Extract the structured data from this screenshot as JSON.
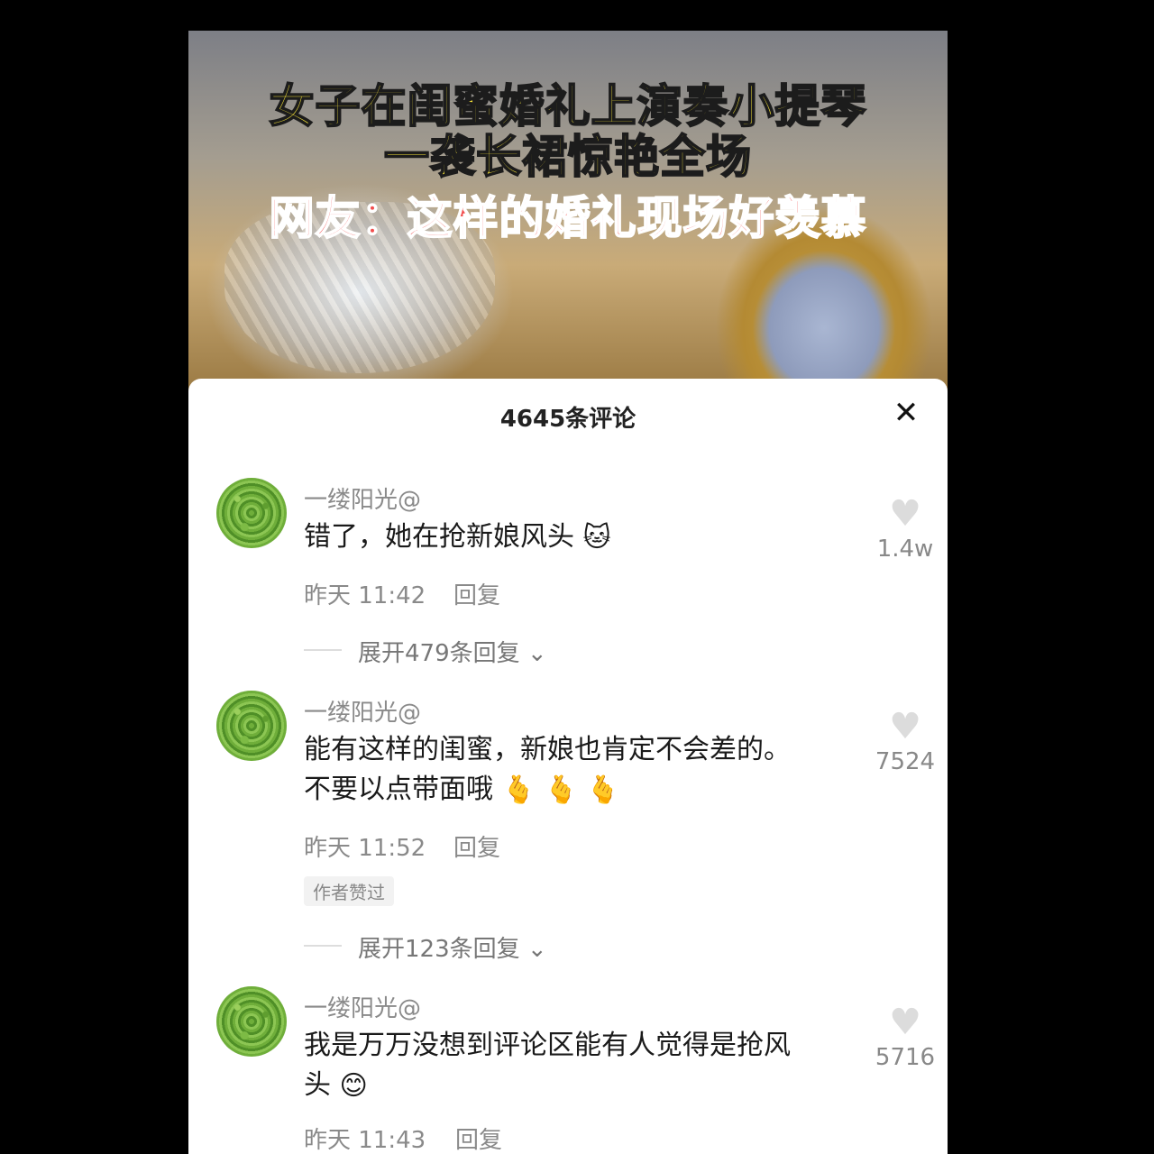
{
  "video": {
    "caption_line1": "女子在闺蜜婚礼上演奏小提琴",
    "caption_line2": "一袭长裙惊艳全场",
    "caption_line3": "网友：这样的婚礼现场好羡慕"
  },
  "comments_panel": {
    "title": "4645条评论",
    "close_icon": "close-icon"
  },
  "comments": [
    {
      "username": "一缕阳光@",
      "text_before_emoji": "错了，她在抢新娘风头",
      "emoji": "cat-emoji",
      "time": "昨天 11:42",
      "reply_label": "回复",
      "likes": "1.4w",
      "expand_label": "展开479条回复"
    },
    {
      "username": "一缕阳光@",
      "text_line1": "能有这样的闺蜜，新娘也肯定不会差的。",
      "text_line2": "不要以点带面哦",
      "emoji": "finger-heart-emoji",
      "time": "昨天 11:52",
      "reply_label": "回复",
      "badge": "作者赞过",
      "likes": "7524",
      "expand_label": "展开123条回复"
    },
    {
      "username": "一缕阳光@",
      "text_line1": "我是万万没想到评论区能有人觉得是抢风",
      "text_line2": "头",
      "emoji": "smile-emoji",
      "time": "昨天 11:43",
      "reply_label": "回复",
      "likes": "5716"
    }
  ],
  "colors": {
    "caption_yellow": "#f6e33a",
    "caption_red": "#f24d4d",
    "meta_gray": "#8a8a8a",
    "heart_gray": "#dcdcdc"
  }
}
